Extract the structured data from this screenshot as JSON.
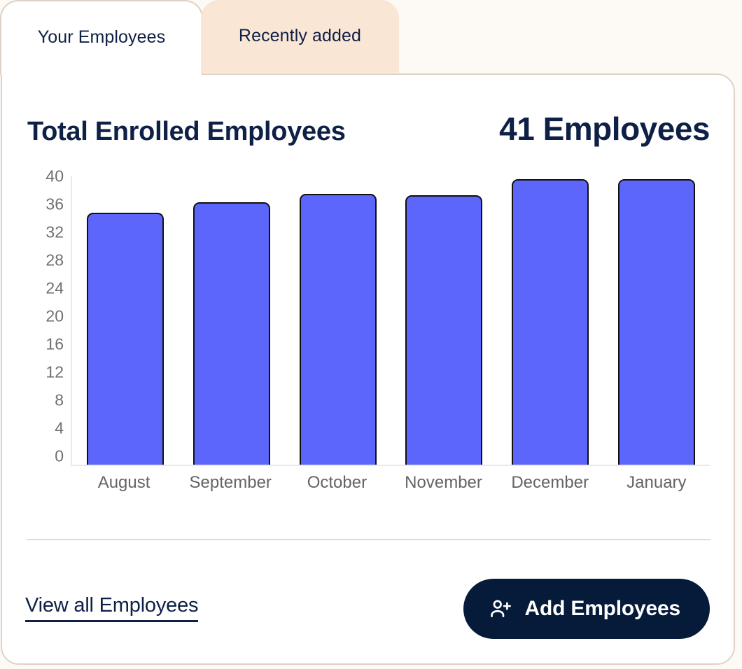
{
  "tabs": [
    {
      "label": "Your Employees",
      "active": true
    },
    {
      "label": "Recently added",
      "active": false
    }
  ],
  "header": {
    "chart_title": "Total Enrolled Employees",
    "total_label": "41 Employees"
  },
  "footer": {
    "view_all_label": "View all Employees",
    "add_button_label": "Add Employees",
    "add_button_icon": "person-plus-icon"
  },
  "colors": {
    "bar_fill": "#5c66fa",
    "bar_stroke": "#10100f",
    "navy": "#0e2045",
    "button_bg": "#061a3a",
    "card_border": "#ddd2c6",
    "inactive_tab_bg": "#fae6d5",
    "page_bg": "#fdfaf6"
  },
  "chart_data": {
    "type": "bar",
    "title": "Total Enrolled Employees",
    "xlabel": "",
    "ylabel": "",
    "categories": [
      "August",
      "September",
      "October",
      "November",
      "December",
      "January"
    ],
    "values": [
      36,
      37.5,
      38.7,
      38.5,
      40.8,
      40.8
    ],
    "ylim": [
      0,
      40
    ],
    "yticks": [
      40,
      36,
      32,
      28,
      24,
      20,
      16,
      12,
      8,
      4,
      0
    ],
    "grid": false,
    "legend": false
  }
}
